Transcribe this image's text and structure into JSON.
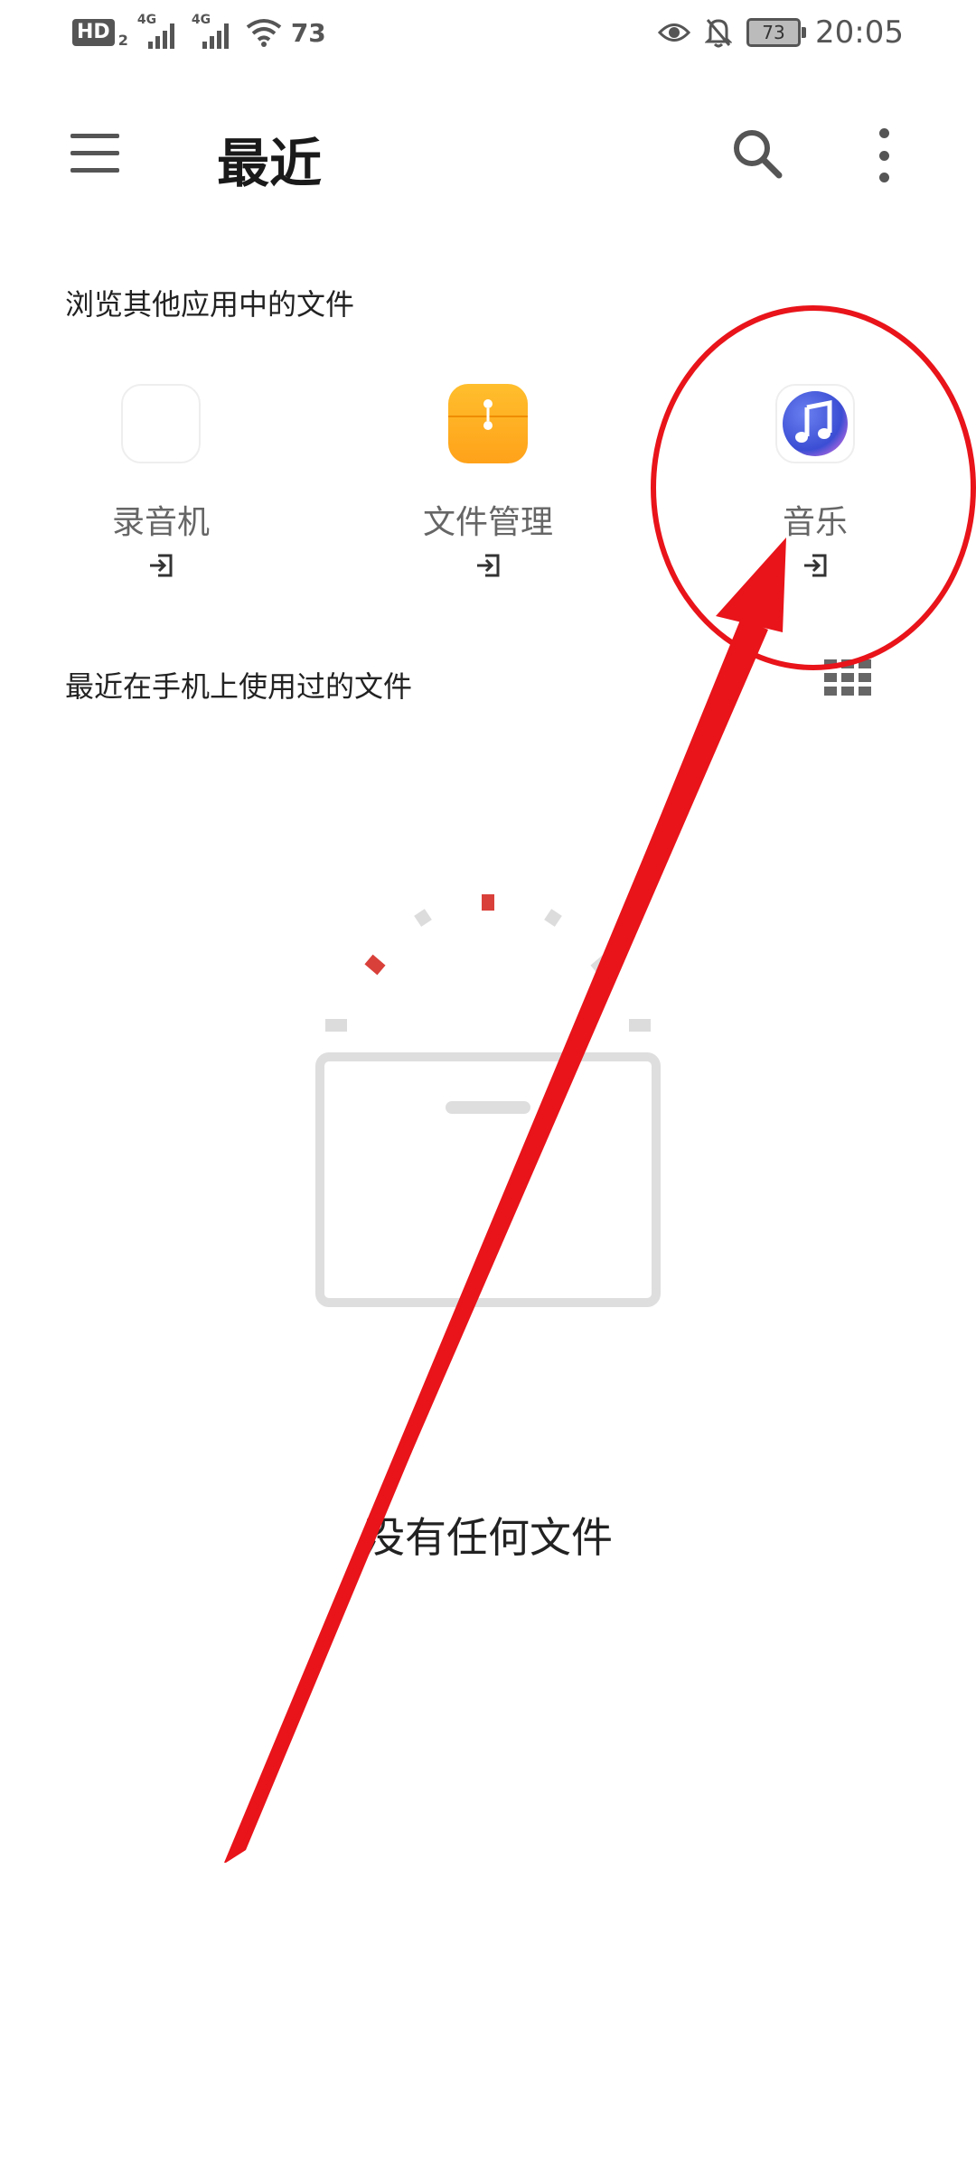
{
  "status_bar": {
    "hd": "HD",
    "hd_sub": "2",
    "signal1_label": "4G",
    "signal2_label": "4G",
    "wifi_value": "73",
    "battery": "73",
    "time": "20:05"
  },
  "header": {
    "title": "最近"
  },
  "browse_section": {
    "title": "浏览其他应用中的文件",
    "apps": [
      {
        "label": "录音机",
        "icon": "recorder-waveform-icon"
      },
      {
        "label": "文件管理",
        "icon": "file-folder-icon"
      },
      {
        "label": "音乐",
        "icon": "music-note-icon"
      }
    ]
  },
  "recent_section": {
    "title": "最近在手机上使用过的文件"
  },
  "empty_state": {
    "text": "没有任何文件"
  },
  "colors": {
    "annotation_red": "#e8141a",
    "folder_orange": "#ffa21a",
    "icon_gray": "#555555"
  }
}
